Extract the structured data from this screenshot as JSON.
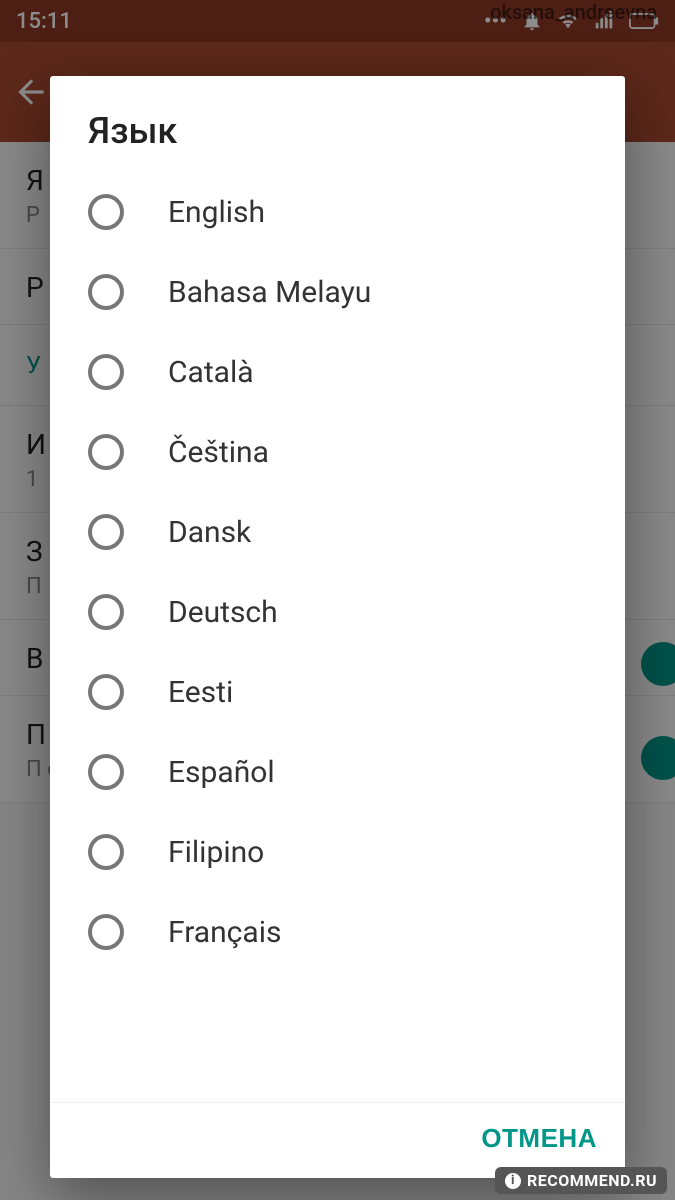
{
  "statusbar": {
    "time": "15:11"
  },
  "settings_bg": {
    "rows": [
      {
        "title": "Я",
        "sub": "Р"
      },
      {
        "title": "Р",
        "sub": ""
      },
      {
        "section": "У"
      },
      {
        "title": "И",
        "sub": "1"
      },
      {
        "title": "З",
        "sub": "П"
      },
      {
        "title": "В",
        "sub": ""
      },
      {
        "title": "П",
        "sub": "П\nс"
      }
    ]
  },
  "dialog": {
    "title": "Язык",
    "languages": [
      "English",
      "Bahasa Melayu",
      "Català",
      "Čeština",
      "Dansk",
      "Deutsch",
      "Eesti",
      "Español",
      "Filipino",
      "Français"
    ],
    "cancel": "ОТМЕНА"
  },
  "watermark": {
    "user": "oksana_andreevna",
    "site": "RECOMMEND.RU"
  }
}
